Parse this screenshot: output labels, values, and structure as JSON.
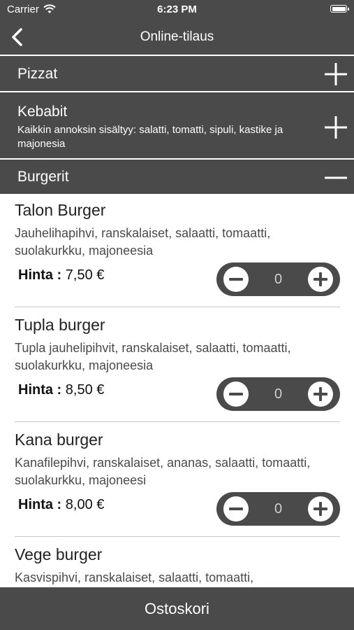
{
  "status_bar": {
    "carrier": "Carrier",
    "time": "6:23 PM",
    "wifi_icon": "wifi-icon",
    "battery_icon": "battery-icon"
  },
  "nav": {
    "title": "Online-tilaus",
    "back_icon": "chevron-left-icon"
  },
  "categories": [
    {
      "name": "Pizzat",
      "subtitle": "",
      "expanded": false,
      "toggle_icon": "plus-icon"
    },
    {
      "name": "Kebabit",
      "subtitle": "Kaikkin annoksin sisältyy: salatti, tomatti, sipuli, kastike ja majonesia",
      "expanded": false,
      "toggle_icon": "plus-icon"
    },
    {
      "name": "Burgerit",
      "subtitle": "",
      "expanded": true,
      "toggle_icon": "minus-icon"
    }
  ],
  "items": [
    {
      "name": "Talon Burger",
      "description": "Jauhelihapihvi, ranskalaiset, salaatti, tomaatti, suolakurkku, majoneesia",
      "price_label": "Hinta :",
      "price": "7,50 €",
      "quantity": "0"
    },
    {
      "name": "Tupla burger",
      "description": "Tupla jauhelipihvit, ranskalaiset, salaatti, tomaatti, suolakurkku, majoneesia",
      "price_label": "Hinta :",
      "price": "8,50 €",
      "quantity": "0"
    },
    {
      "name": "Kana burger",
      "description": "Kanafilepihvi, ranskalaiset, ananas, salaatti, tomaatti, suolakurkku, majoneesi",
      "price_label": "Hinta :",
      "price": "8,00 €",
      "quantity": "0"
    },
    {
      "name": "Vege burger",
      "description": "Kasvispihvi, ranskalaiset, salaatti, tomaatti,",
      "price_label": "",
      "price": "",
      "quantity": ""
    }
  ],
  "cart": {
    "label": "Ostoskori"
  },
  "colors": {
    "bar": "#4a4a4a",
    "background": "#ffffff",
    "text": "#222222",
    "divider": "#c8c8c8"
  }
}
